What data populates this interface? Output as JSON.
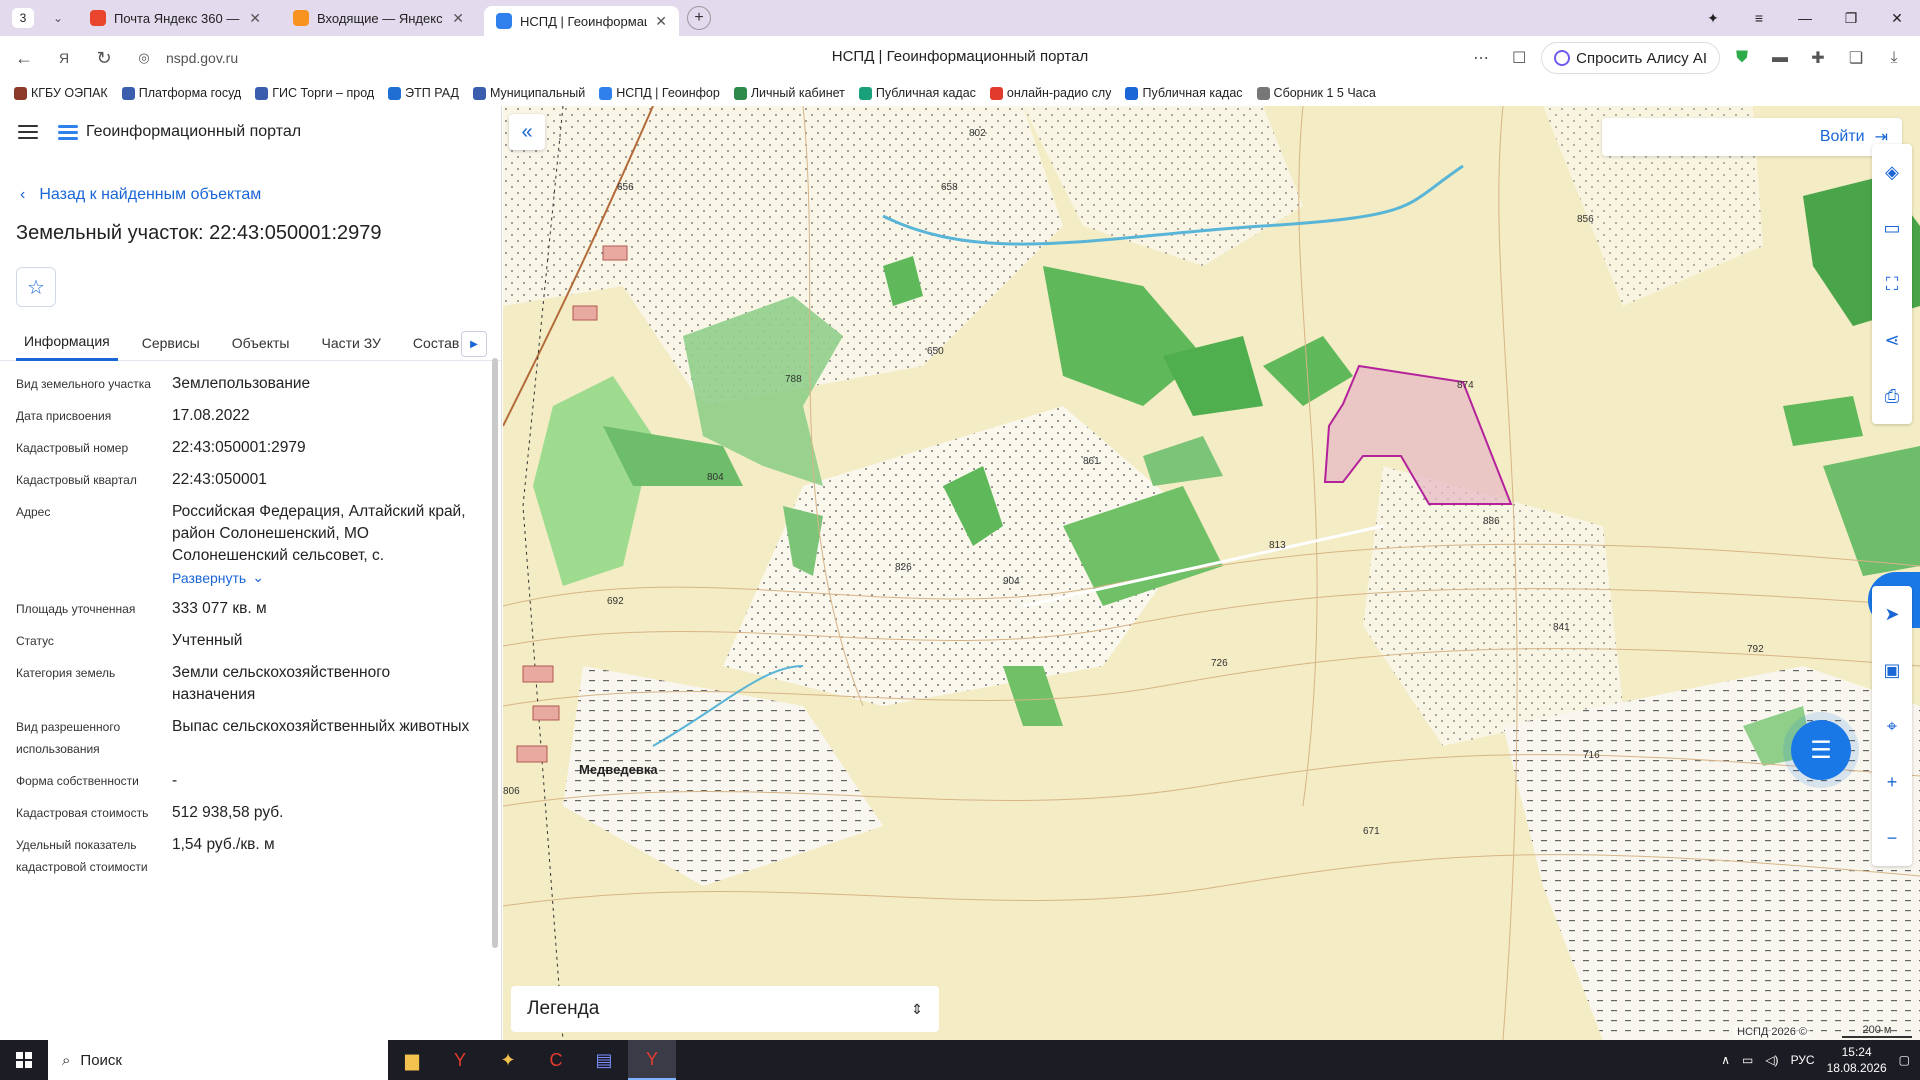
{
  "browser": {
    "tab_count": "3",
    "tabs": [
      {
        "title": "Почта Яндекс 360 — бесп",
        "color": "#e8452c"
      },
      {
        "title": "Входящие — Яндекс Почт",
        "color": "#f7931e"
      },
      {
        "title": "НСПД | Геоинформаци",
        "color": "#2f80ed"
      }
    ],
    "url": "nspd.gov.ru",
    "page_title": "НСПД | Геоинформационный портал",
    "alice_label": "Спросить Алису AI"
  },
  "bookmarks": [
    "КГБУ ОЭПАК",
    "Платформа госуд",
    "ГИС Торги – прод",
    "ЭТП РАД",
    "Муниципальный",
    "НСПД | Геоинфор",
    "Личный кабинет",
    "Публичная кадас",
    "онлайн-радио слу",
    "Публичная кадас",
    "Сборник 1 5 Часа"
  ],
  "panel": {
    "app_name": "Геоинформационный портал",
    "back_link": "Назад к найденным объектам",
    "title": "Земельный участок: 22:43:050001:2979",
    "tabs": [
      "Информация",
      "Сервисы",
      "Объекты",
      "Части ЗУ",
      "Состав"
    ],
    "expand_label": "Развернуть",
    "props": [
      {
        "k": "Вид земельного участка",
        "v": "Землепользование"
      },
      {
        "k": "Дата присвоения",
        "v": "17.08.2022"
      },
      {
        "k": "Кадастровый номер",
        "v": "22:43:050001:2979"
      },
      {
        "k": "Кадастровый квартал",
        "v": "22:43:050001"
      },
      {
        "k": "Адрес",
        "v": "Российская Федерация, Алтайский край, район Солонешенский, МО Солонешенский сельсовет, с."
      },
      {
        "k": "Площадь уточненная",
        "v": "333 077 кв. м"
      },
      {
        "k": "Статус",
        "v": "Учтенный"
      },
      {
        "k": "Категория земель",
        "v": "Земли сельскохозяйственного назначения"
      },
      {
        "k": "Вид разрешенного использования",
        "v": "Выпас сельскохозяйственныйх животных"
      },
      {
        "k": "Форма собственности",
        "v": "-"
      },
      {
        "k": "Кадастровая стоимость",
        "v": "512 938,58 руб."
      },
      {
        "k": "Удельный показатель кадастровой стоимости",
        "v": "1,54 руб./кв. м"
      }
    ]
  },
  "map": {
    "login_label": "Войти",
    "legend_label": "Легенда",
    "copyright": "НСПД 2026 ©",
    "scale": "200 м",
    "village": "Медведевка",
    "labels": [
      "802",
      "656",
      "788",
      "804",
      "826",
      "904",
      "692",
      "861",
      "874",
      "856",
      "886",
      "813",
      "841",
      "792",
      "726",
      "716",
      "806",
      "671",
      "650",
      "658"
    ]
  },
  "taskbar": {
    "search_label": "Поиск",
    "lang": "РУС",
    "time": "15:24",
    "date": "18.08.2026"
  }
}
